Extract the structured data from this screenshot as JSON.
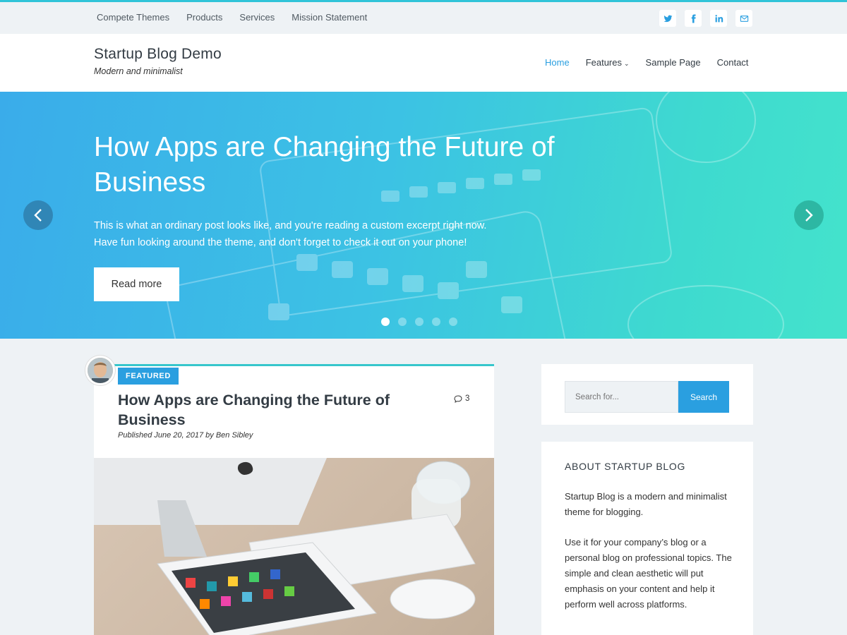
{
  "topbar": {
    "nav": [
      "Compete Themes",
      "Products",
      "Services",
      "Mission Statement"
    ],
    "social": [
      "twitter-icon",
      "facebook-icon",
      "linkedin-icon",
      "email-icon"
    ],
    "accent_color": "#2fc4d8"
  },
  "header": {
    "title": "Startup Blog Demo",
    "tagline": "Modern and minimalist",
    "nav": [
      "Home",
      "Features",
      "Sample Page",
      "Contact"
    ],
    "active": "Home",
    "link_color": "#2a9fe0"
  },
  "hero": {
    "title": "How Apps are Changing the Future of Business",
    "excerpt_line1": "This is what an ordinary post looks like, and you're reading a custom excerpt right now.",
    "excerpt_line2": "Have fun looking around the theme, and don't forget to check it out on your phone!",
    "button": "Read more",
    "slide_count": 5,
    "active_slide": 1
  },
  "post": {
    "badge": "FEATURED",
    "title": "How Apps are Changing the Future of Business",
    "comment_count": "3",
    "byline": "Published June 20, 2017 by Ben Sibley"
  },
  "sidebar": {
    "search_placeholder": "Search for...",
    "search_button": "Search",
    "about_title": "ABOUT STARTUP BLOG",
    "about_p1": "Startup Blog is a modern and minimalist theme for blogging.",
    "about_p2": "Use it for your company’s blog or a personal blog on professional topics. The simple and clean aesthetic will put emphasis on your content and help it perform well across platforms."
  }
}
